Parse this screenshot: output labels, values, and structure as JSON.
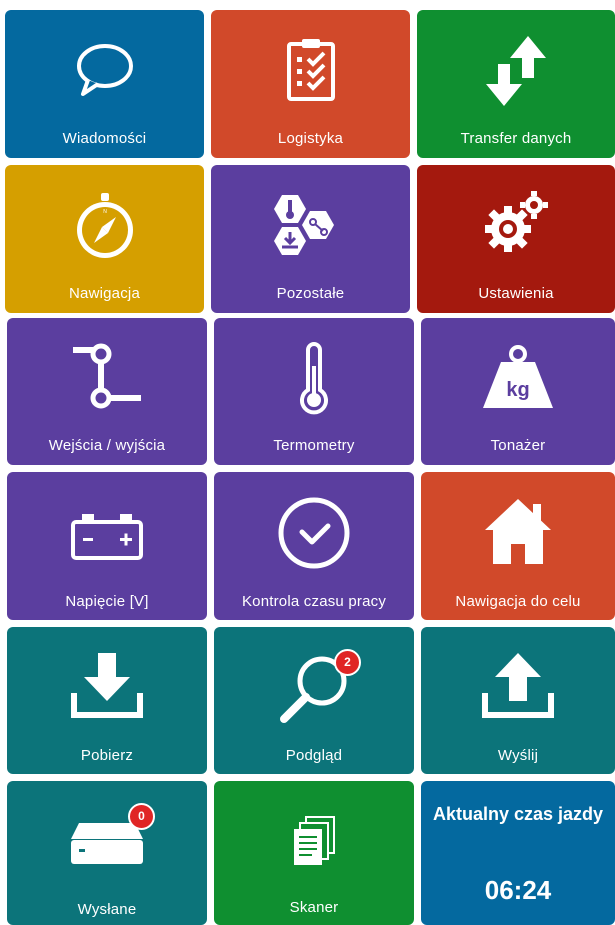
{
  "colors": {
    "blue": "#04699f",
    "orange_red": "#d1492a",
    "green": "#0f8f30",
    "amber": "#d59f00",
    "purple": "#5b3e9f",
    "dark_red": "#a4190e",
    "teal": "#0c747a",
    "badge_red": "#e02525"
  },
  "tiles": [
    {
      "label": "Wiadomości",
      "icon": "chat-bubble-icon"
    },
    {
      "label": "Logistyka",
      "icon": "clipboard-checklist-icon"
    },
    {
      "label": "Transfer danych",
      "icon": "transfer-arrows-icon"
    },
    {
      "label": "Nawigacja",
      "icon": "compass-icon"
    },
    {
      "label": "Pozostałe",
      "icon": "hexagon-cluster-icon"
    },
    {
      "label": "Ustawienia",
      "icon": "gears-icon"
    },
    {
      "label": "Wejścia / wyjścia",
      "icon": "io-connector-icon"
    },
    {
      "label": "Termometry",
      "icon": "thermometer-icon"
    },
    {
      "label": "Tonażer",
      "icon": "weight-kg-icon",
      "icon_text": "kg"
    },
    {
      "label": "Napięcie [V]",
      "icon": "battery-icon"
    },
    {
      "label": "Kontrola czasu pracy",
      "icon": "check-circle-icon"
    },
    {
      "label": "Nawigacja do celu",
      "icon": "home-icon"
    },
    {
      "label": "Pobierz",
      "icon": "download-icon"
    },
    {
      "label": "Podgląd",
      "icon": "magnifier-icon",
      "badge": "2"
    },
    {
      "label": "Wyślij",
      "icon": "upload-icon"
    },
    {
      "label": "Wysłane",
      "icon": "outbox-tray-icon",
      "badge": "0"
    },
    {
      "label": "Skaner",
      "icon": "documents-icon"
    }
  ],
  "clock": {
    "title": "Aktualny czas jazdy",
    "time": "06:24"
  }
}
